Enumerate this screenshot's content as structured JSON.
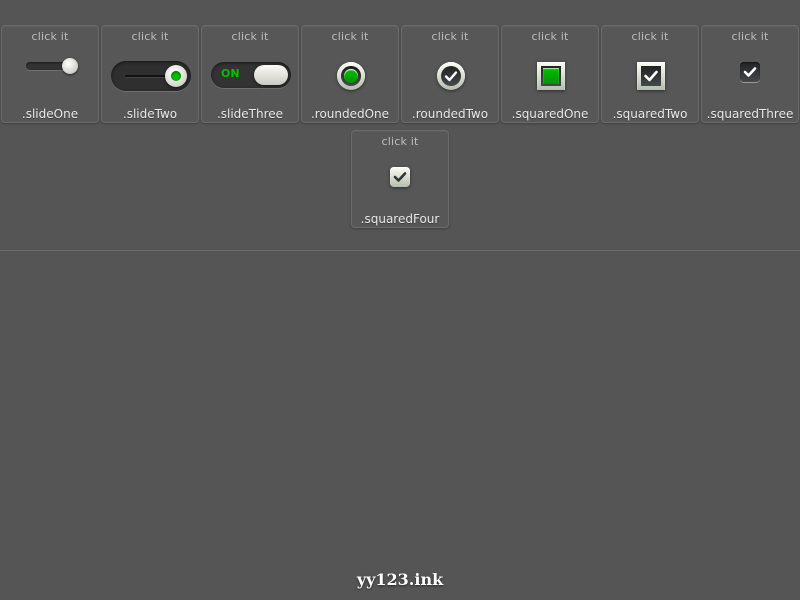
{
  "demos": [
    {
      "hint": "click it",
      "name": ".slideOne"
    },
    {
      "hint": "click it",
      "name": ".slideTwo"
    },
    {
      "hint": "click it",
      "name": ".slideThree",
      "state_text": "ON"
    },
    {
      "hint": "click it",
      "name": ".roundedOne"
    },
    {
      "hint": "click it",
      "name": ".roundedTwo"
    },
    {
      "hint": "click it",
      "name": ".squaredOne"
    },
    {
      "hint": "click it",
      "name": ".squaredTwo"
    },
    {
      "hint": "click it",
      "name": ".squaredThree"
    },
    {
      "hint": "click it",
      "name": ".squaredFour"
    }
  ],
  "footer": {
    "watermark": "yy123.ink"
  },
  "colors": {
    "background": "#555555",
    "accent_green": "#00bf00",
    "knob_light": "#e6e7de",
    "track_dark": "#2f2f2f"
  },
  "icons": [
    "check-icon",
    "toggle-knob-icon",
    "radio-dot-icon"
  ]
}
